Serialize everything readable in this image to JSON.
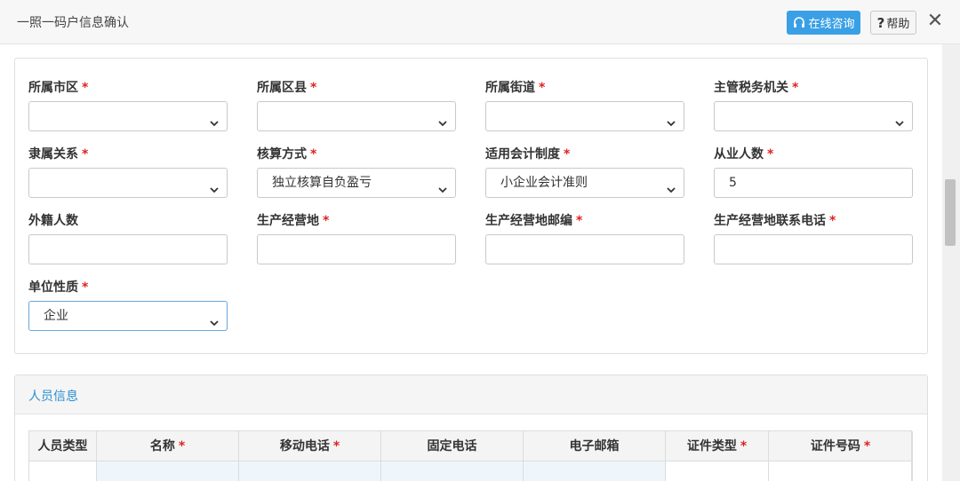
{
  "dialog": {
    "title": "一照一码户信息确认",
    "consult_label": "在线咨询",
    "help_label": "帮助",
    "close_glyph": "✕"
  },
  "form": {
    "fields": [
      {
        "label": "所属市区",
        "required": true,
        "type": "select",
        "value": ""
      },
      {
        "label": "所属区县",
        "required": true,
        "type": "select",
        "value": ""
      },
      {
        "label": "所属街道",
        "required": true,
        "type": "select",
        "value": ""
      },
      {
        "label": "主管税务机关",
        "required": true,
        "type": "select",
        "value": ""
      },
      {
        "label": "隶属关系",
        "required": true,
        "type": "select",
        "value": ""
      },
      {
        "label": "核算方式",
        "required": true,
        "type": "select",
        "value": "独立核算自负盈亏"
      },
      {
        "label": "适用会计制度",
        "required": true,
        "type": "select",
        "value": "小企业会计准则"
      },
      {
        "label": "从业人数",
        "required": true,
        "type": "input",
        "value": "5"
      },
      {
        "label": "外籍人数",
        "required": false,
        "type": "input",
        "value": ""
      },
      {
        "label": "生产经营地",
        "required": true,
        "type": "input",
        "value": ""
      },
      {
        "label": "生产经营地邮编",
        "required": true,
        "type": "input",
        "value": ""
      },
      {
        "label": "生产经营地联系电话",
        "required": true,
        "type": "input",
        "value": ""
      },
      {
        "label": "单位性质",
        "required": true,
        "type": "select",
        "value": "企业"
      }
    ],
    "required_mark": "*"
  },
  "personnel": {
    "title": "人员信息",
    "columns": [
      {
        "label": "人员类型",
        "required": false
      },
      {
        "label": "名称",
        "required": true
      },
      {
        "label": "移动电话",
        "required": true
      },
      {
        "label": "固定电话",
        "required": false
      },
      {
        "label": "电子邮箱",
        "required": false
      },
      {
        "label": "证件类型",
        "required": true
      },
      {
        "label": "证件号码",
        "required": true
      }
    ]
  },
  "colors": {
    "accent": "#3aa0e6",
    "required": "#dd2222",
    "section_title": "#2b8ed1"
  }
}
